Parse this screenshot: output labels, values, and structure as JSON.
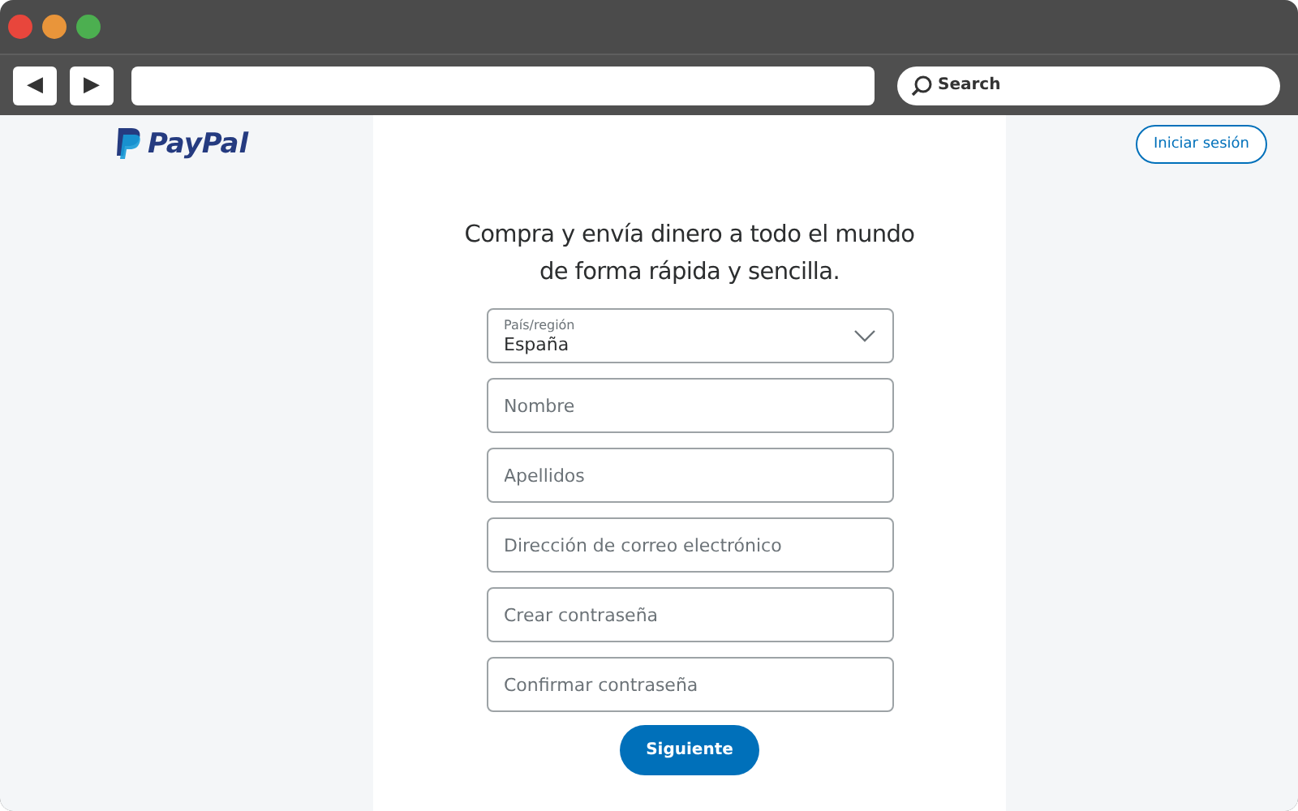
{
  "browser": {
    "window_controls": [
      {
        "color": "#e8463c"
      },
      {
        "color": "#e9953a"
      },
      {
        "color": "#4caf50"
      }
    ],
    "nav_buttons": [
      {
        "symbol": "◀"
      },
      {
        "symbol": "▶"
      }
    ],
    "search": {
      "placeholder": "Search"
    }
  },
  "header": {
    "logo": "PayPal",
    "login_button": "Iniciar sesión"
  },
  "form": {
    "heading": "Compra y envía dinero a todo el mundo de forma rápida y sencilla.",
    "fields": [
      {
        "kind": "select",
        "label": "País/región",
        "value": "España"
      },
      {
        "kind": "text",
        "placeholder": "Nombre"
      },
      {
        "kind": "text",
        "placeholder": "Apellidos"
      },
      {
        "kind": "text",
        "placeholder": "Dirección de correo electrónico"
      },
      {
        "kind": "password",
        "placeholder": "Crear contraseña"
      },
      {
        "kind": "password",
        "placeholder": "Confirmar contraseña"
      }
    ],
    "submit": "Siguiente"
  }
}
